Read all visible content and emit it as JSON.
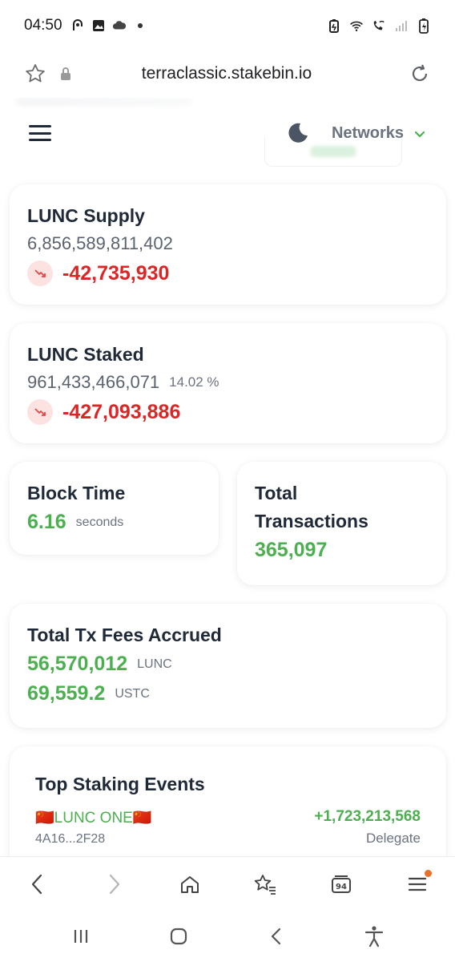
{
  "status_bar": {
    "time": "04:50",
    "left_icons": [
      "podcast-icon",
      "gallery-icon",
      "cloud-icon",
      "dot-icon"
    ],
    "right_icons": [
      "battery-saver-icon",
      "wifi-icon",
      "wifi-call-icon",
      "signal-icon",
      "battery-icon"
    ]
  },
  "browser": {
    "url": "terraclassic.stakebin.io",
    "tab_count": "94"
  },
  "topnav": {
    "networks_label": "Networks"
  },
  "supply": {
    "title": "LUNC Supply",
    "value": "6,856,589,811,402",
    "change": "-42,735,930"
  },
  "staked": {
    "title": "LUNC Staked",
    "value": "961,433,466,071",
    "percent": "14.02 %",
    "change": "-427,093,886"
  },
  "block_time": {
    "title": "Block Time",
    "value": "6.16",
    "unit": "seconds"
  },
  "transactions": {
    "title_line1": "Total",
    "title_line2": "Transactions",
    "value": "365,097"
  },
  "fees": {
    "title": "Total Tx Fees Accrued",
    "lunc_value": "56,570,012",
    "lunc_unit": "LUNC",
    "ustc_value": "69,559.2",
    "ustc_unit": "USTC"
  },
  "staking_events": {
    "title": "Top Staking Events",
    "items": [
      {
        "validator": "🇨🇳LUNC ONE🇨🇳",
        "address": "4A16...2F28",
        "amount": "+1,723,213,568",
        "type": "Delegate"
      }
    ]
  },
  "colors": {
    "green": "#4caf50",
    "red": "#dc2626",
    "text": "#1f2937"
  }
}
